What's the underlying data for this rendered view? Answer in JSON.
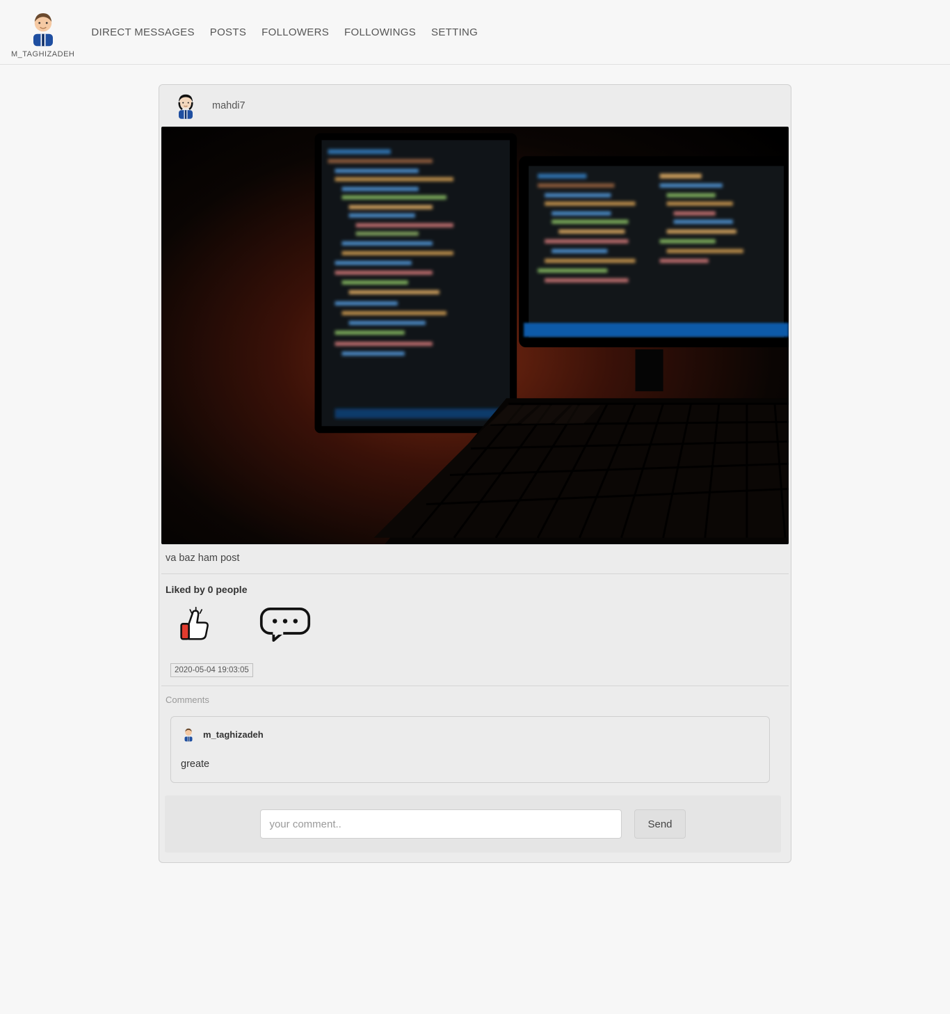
{
  "nav": {
    "username": "M_TAGHIZADEH",
    "links": [
      {
        "label": "DIRECT MESSAGES"
      },
      {
        "label": "POSTS"
      },
      {
        "label": "FOLLOWERS"
      },
      {
        "label": "FOLLOWINGS"
      },
      {
        "label": "SETTING"
      }
    ]
  },
  "post": {
    "author": "mahdi7",
    "caption": "va baz ham post",
    "likes_text": "Liked by 0 people",
    "timestamp": "2020-05-04 19:03:05",
    "comments_label": "Comments",
    "comments": [
      {
        "author": "m_taghizadeh",
        "body": "greate"
      }
    ],
    "form": {
      "placeholder": "your comment..",
      "send_label": "Send"
    }
  },
  "colors": {
    "skin": "#f5c9a3",
    "hair": "#6b4a2e",
    "suit": "#1f4fa1",
    "shirt": "#ffffff",
    "tie": "#0d2d66"
  }
}
